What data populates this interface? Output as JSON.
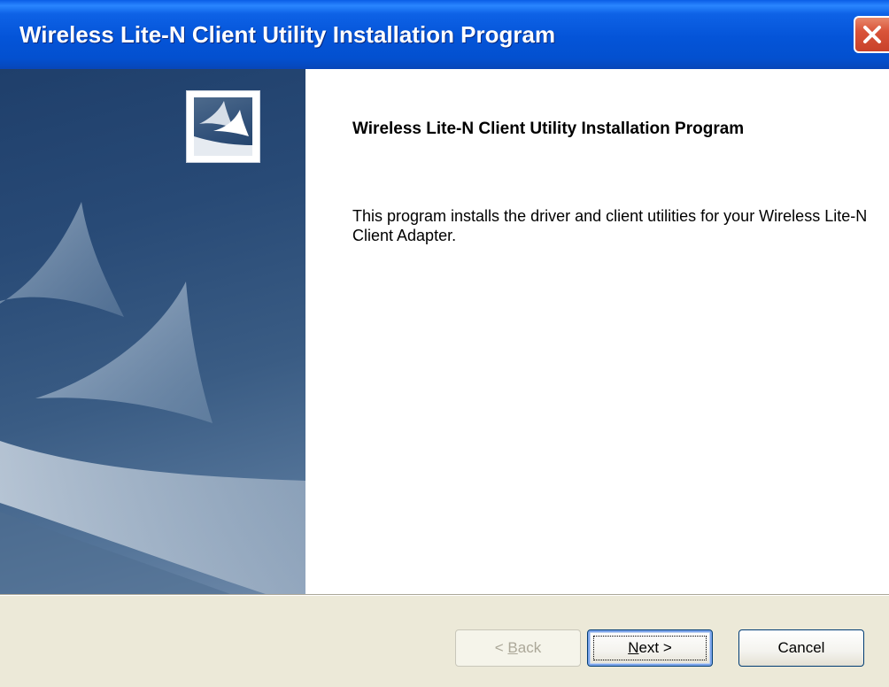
{
  "window": {
    "title": "Wireless Lite-N Client Utility Installation Program"
  },
  "content": {
    "heading": "Wireless Lite-N Client Utility Installation Program",
    "description": "This program installs the driver and client utilities for your Wireless Lite-N Client Adapter."
  },
  "buttons": {
    "back": {
      "prefix": "< ",
      "accel": "B",
      "rest": "ack",
      "enabled": false
    },
    "next": {
      "accel": "N",
      "rest": "ext >",
      "enabled": true
    },
    "cancel": {
      "label": "Cancel",
      "enabled": true
    }
  },
  "icons": {
    "close": "close-x-icon",
    "logo": "sail-logo-icon"
  },
  "colors": {
    "titlebar": "#0454d8",
    "close_button": "#d9543a",
    "sidepanel": "#284a76",
    "dialog_face": "#ece9d8",
    "disabled_text": "#aca899"
  }
}
